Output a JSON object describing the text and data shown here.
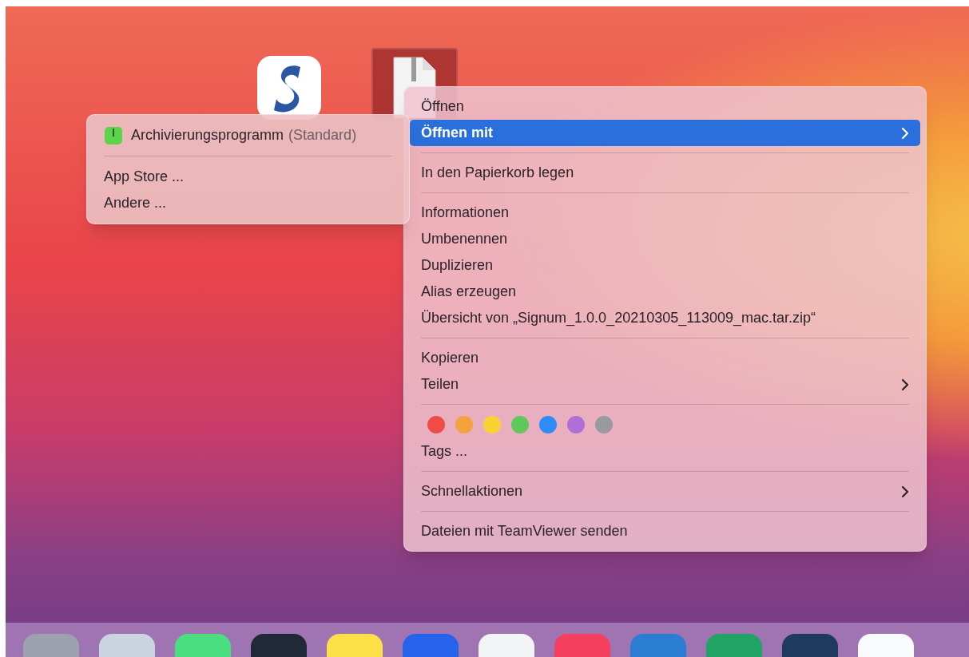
{
  "desktop_icons": [
    {
      "kind": "app",
      "selected": false
    },
    {
      "kind": "archive",
      "selected": true
    }
  ],
  "context_menu": {
    "groups": [
      [
        {
          "kind": "item",
          "label": "Öffnen",
          "selected": false,
          "has_submenu": false
        },
        {
          "kind": "item",
          "label": "Öffnen mit",
          "selected": true,
          "has_submenu": true
        }
      ],
      [
        {
          "kind": "item",
          "label": "In den Papierkorb legen",
          "selected": false,
          "has_submenu": false
        }
      ],
      [
        {
          "kind": "item",
          "label": "Informationen",
          "selected": false,
          "has_submenu": false
        },
        {
          "kind": "item",
          "label": "Umbenennen",
          "selected": false,
          "has_submenu": false
        },
        {
          "kind": "item",
          "label": "Duplizieren",
          "selected": false,
          "has_submenu": false
        },
        {
          "kind": "item",
          "label": "Alias erzeugen",
          "selected": false,
          "has_submenu": false
        },
        {
          "kind": "item",
          "label": "Übersicht von „Signum_1.0.0_20210305_113009_mac.tar.zip“",
          "selected": false,
          "has_submenu": false
        }
      ],
      [
        {
          "kind": "item",
          "label": "Kopieren",
          "selected": false,
          "has_submenu": false
        },
        {
          "kind": "item",
          "label": "Teilen",
          "selected": false,
          "has_submenu": true
        }
      ],
      [
        {
          "kind": "tags",
          "colors": [
            {
              "color": "#ee4d47"
            },
            {
              "color": "#f4a23a"
            },
            {
              "color": "#f7d232"
            },
            {
              "color": "#5ec95a"
            },
            {
              "color": "#2f8cf4"
            },
            {
              "color": "#b06fd8"
            },
            {
              "color": "#9a9a9e"
            }
          ]
        },
        {
          "kind": "item",
          "label": "Tags ...",
          "selected": false,
          "has_submenu": false
        }
      ],
      [
        {
          "kind": "item",
          "label": "Schnellaktionen",
          "selected": false,
          "has_submenu": true
        }
      ],
      [
        {
          "kind": "item",
          "label": "Dateien mit TeamViewer senden",
          "selected": false,
          "has_submenu": false
        }
      ]
    ]
  },
  "submenu": {
    "groups": [
      [
        {
          "kind": "app",
          "label": "Archivierungsprogramm",
          "note": "(Standard)"
        }
      ],
      [
        {
          "kind": "item",
          "label": "App Store ..."
        },
        {
          "kind": "item",
          "label": "Andere ..."
        }
      ]
    ]
  }
}
